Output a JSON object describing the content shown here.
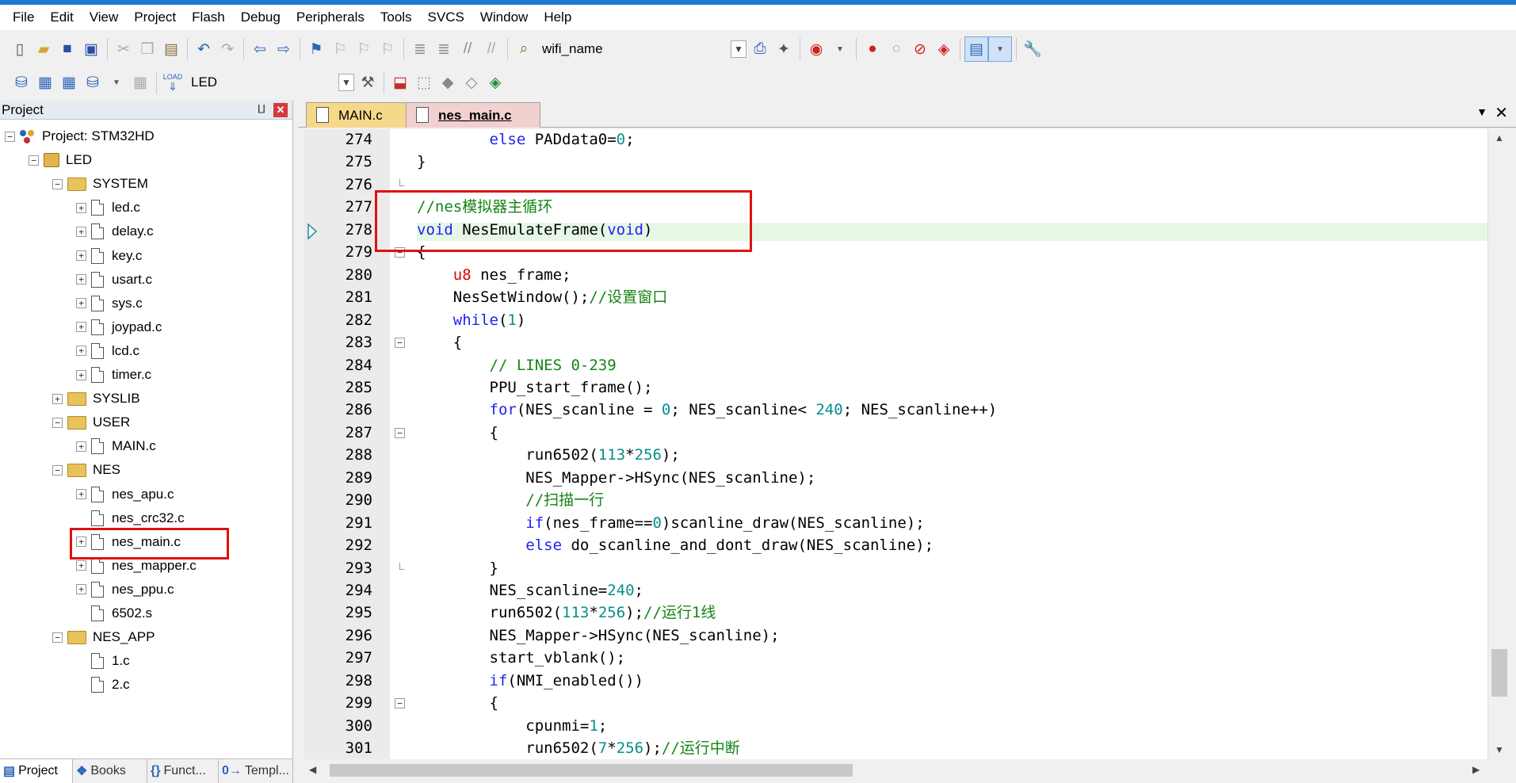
{
  "menubar": {
    "items": [
      "File",
      "Edit",
      "View",
      "Project",
      "Flash",
      "Debug",
      "Peripherals",
      "Tools",
      "SVCS",
      "Window",
      "Help"
    ]
  },
  "toolbar1": {
    "find_combo_value": "wifi_name"
  },
  "toolbar2": {
    "target_combo_value": "LED",
    "load_label": "LOAD"
  },
  "project_panel": {
    "title": "Project",
    "pin": "⨿",
    "close": "✕",
    "tree": [
      {
        "label": "Project: STM32HD",
        "type": "project",
        "toggle": "−"
      },
      {
        "label": "LED",
        "type": "target",
        "toggle": "−"
      },
      {
        "label": "SYSTEM",
        "type": "folder",
        "toggle": "−"
      },
      {
        "label": "led.c",
        "type": "file",
        "toggle": "+"
      },
      {
        "label": "delay.c",
        "type": "file",
        "toggle": "+"
      },
      {
        "label": "key.c",
        "type": "file",
        "toggle": "+"
      },
      {
        "label": "usart.c",
        "type": "file",
        "toggle": "+"
      },
      {
        "label": "sys.c",
        "type": "file",
        "toggle": "+"
      },
      {
        "label": "joypad.c",
        "type": "file",
        "toggle": "+"
      },
      {
        "label": "lcd.c",
        "type": "file",
        "toggle": "+"
      },
      {
        "label": "timer.c",
        "type": "file",
        "toggle": "+"
      },
      {
        "label": "SYSLIB",
        "type": "folder",
        "toggle": "+"
      },
      {
        "label": "USER",
        "type": "folder",
        "toggle": "−"
      },
      {
        "label": "MAIN.c",
        "type": "file",
        "toggle": "+"
      },
      {
        "label": "NES",
        "type": "folder",
        "toggle": "−"
      },
      {
        "label": "nes_apu.c",
        "type": "file",
        "toggle": "+"
      },
      {
        "label": "nes_crc32.c",
        "type": "file",
        "toggle": ""
      },
      {
        "label": "nes_main.c",
        "type": "file",
        "toggle": "+"
      },
      {
        "label": "nes_mapper.c",
        "type": "file",
        "toggle": "+"
      },
      {
        "label": "nes_ppu.c",
        "type": "file",
        "toggle": "+"
      },
      {
        "label": "6502.s",
        "type": "file",
        "toggle": ""
      },
      {
        "label": "NES_APP",
        "type": "folder",
        "toggle": "−"
      },
      {
        "label": "1.c",
        "type": "file",
        "toggle": ""
      },
      {
        "label": "2.c",
        "type": "file",
        "toggle": ""
      }
    ],
    "bottom_tabs": [
      {
        "label": "Project",
        "icon": "▤"
      },
      {
        "label": "Books",
        "icon": "❖"
      },
      {
        "label": "Funct...",
        "icon": "{}"
      },
      {
        "label": "Templ...",
        "icon": "0→"
      }
    ]
  },
  "editor": {
    "tabs": [
      "MAIN.c",
      "nes_main.c"
    ],
    "active_tab": "nes_main.c",
    "tab_menu": "▼",
    "tab_close": "✕",
    "lines": [
      {
        "n": "274",
        "fold": "",
        "segs": [
          [
            "        ",
            ""
          ],
          [
            "else",
            "k"
          ],
          [
            " PADdata0=",
            ""
          ],
          [
            "0",
            "n"
          ],
          [
            ";",
            ""
          ]
        ]
      },
      {
        "n": "275",
        "fold": "",
        "segs": [
          [
            "}",
            ""
          ]
        ]
      },
      {
        "n": "276",
        "fold": "end",
        "segs": []
      },
      {
        "n": "277",
        "fold": "",
        "segs": [
          [
            "//nes模拟器主循环",
            "c"
          ]
        ]
      },
      {
        "n": "278",
        "fold": "",
        "segs": [
          [
            "void",
            "k"
          ],
          [
            " NesEmulateFrame(",
            ""
          ],
          [
            "void",
            "k"
          ],
          [
            ")",
            ""
          ]
        ]
      },
      {
        "n": "279",
        "fold": "−",
        "segs": [
          [
            "{",
            ""
          ]
        ]
      },
      {
        "n": "280",
        "fold": "",
        "segs": [
          [
            "    ",
            ""
          ],
          [
            "u8",
            "r"
          ],
          [
            " nes_frame;",
            ""
          ]
        ]
      },
      {
        "n": "281",
        "fold": "",
        "segs": [
          [
            "    NesSetWindow();",
            ""
          ],
          [
            "//设置窗口",
            "c"
          ]
        ]
      },
      {
        "n": "282",
        "fold": "",
        "segs": [
          [
            "    ",
            ""
          ],
          [
            "while",
            "k"
          ],
          [
            "(",
            ""
          ],
          [
            "1",
            "n"
          ],
          [
            ")",
            ""
          ]
        ]
      },
      {
        "n": "283",
        "fold": "−",
        "segs": [
          [
            "    {",
            ""
          ]
        ]
      },
      {
        "n": "284",
        "fold": "",
        "segs": [
          [
            "        ",
            ""
          ],
          [
            "// LINES 0-239",
            "c"
          ]
        ]
      },
      {
        "n": "285",
        "fold": "",
        "segs": [
          [
            "        PPU_start_frame();",
            ""
          ]
        ]
      },
      {
        "n": "286",
        "fold": "",
        "segs": [
          [
            "        ",
            ""
          ],
          [
            "for",
            "k"
          ],
          [
            "(NES_scanline = ",
            ""
          ],
          [
            "0",
            "n"
          ],
          [
            "; NES_scanline< ",
            ""
          ],
          [
            "240",
            "n"
          ],
          [
            "; NES_scanline++)",
            ""
          ]
        ]
      },
      {
        "n": "287",
        "fold": "−",
        "segs": [
          [
            "        {",
            ""
          ]
        ]
      },
      {
        "n": "288",
        "fold": "",
        "segs": [
          [
            "            run6502(",
            ""
          ],
          [
            "113",
            "n"
          ],
          [
            "*",
            ""
          ],
          [
            "256",
            "n"
          ],
          [
            ");",
            ""
          ]
        ]
      },
      {
        "n": "289",
        "fold": "",
        "segs": [
          [
            "            NES_Mapper->HSync(NES_scanline);",
            ""
          ]
        ]
      },
      {
        "n": "290",
        "fold": "",
        "segs": [
          [
            "            ",
            ""
          ],
          [
            "//扫描一行",
            "c"
          ]
        ]
      },
      {
        "n": "291",
        "fold": "",
        "segs": [
          [
            "            ",
            ""
          ],
          [
            "if",
            "k"
          ],
          [
            "(nes_frame==",
            ""
          ],
          [
            "0",
            "n"
          ],
          [
            ")scanline_draw(NES_scanline);",
            ""
          ]
        ]
      },
      {
        "n": "292",
        "fold": "",
        "segs": [
          [
            "            ",
            ""
          ],
          [
            "else",
            "k"
          ],
          [
            " do_scanline_and_dont_draw(NES_scanline);",
            ""
          ]
        ]
      },
      {
        "n": "293",
        "fold": "end",
        "segs": [
          [
            "        }",
            ""
          ]
        ]
      },
      {
        "n": "294",
        "fold": "",
        "segs": [
          [
            "        NES_scanline=",
            ""
          ],
          [
            "240",
            "n"
          ],
          [
            ";",
            ""
          ]
        ]
      },
      {
        "n": "295",
        "fold": "",
        "segs": [
          [
            "        run6502(",
            ""
          ],
          [
            "113",
            "n"
          ],
          [
            "*",
            ""
          ],
          [
            "256",
            "n"
          ],
          [
            ");",
            ""
          ],
          [
            "//运行1线",
            "c"
          ]
        ]
      },
      {
        "n": "296",
        "fold": "",
        "segs": [
          [
            "        NES_Mapper->HSync(NES_scanline);",
            ""
          ]
        ]
      },
      {
        "n": "297",
        "fold": "",
        "segs": [
          [
            "        start_vblank();",
            ""
          ]
        ]
      },
      {
        "n": "298",
        "fold": "",
        "segs": [
          [
            "        ",
            ""
          ],
          [
            "if",
            "k"
          ],
          [
            "(NMI_enabled())",
            ""
          ]
        ]
      },
      {
        "n": "299",
        "fold": "−",
        "segs": [
          [
            "        {",
            ""
          ]
        ]
      },
      {
        "n": "300",
        "fold": "",
        "segs": [
          [
            "            cpunmi=",
            ""
          ],
          [
            "1",
            "n"
          ],
          [
            ";",
            ""
          ]
        ]
      },
      {
        "n": "301",
        "fold": "",
        "segs": [
          [
            "            run6502(",
            ""
          ],
          [
            "7",
            "n"
          ],
          [
            "*",
            ""
          ],
          [
            "256",
            "n"
          ],
          [
            ");",
            ""
          ],
          [
            "//运行中断",
            "c"
          ]
        ]
      }
    ]
  },
  "colors": {
    "keyword": "#1f1ff5",
    "comment": "#158515",
    "number": "#0a8c8c",
    "type": "#d00000",
    "annotation_box": "#e01010"
  }
}
